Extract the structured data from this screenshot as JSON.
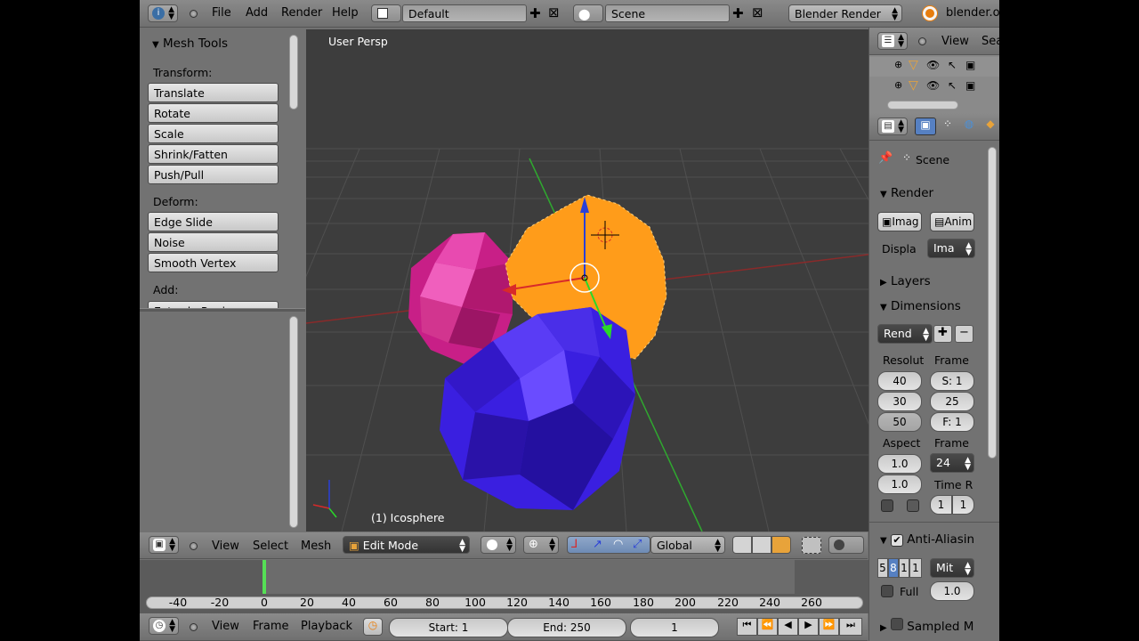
{
  "topbar": {
    "menus": [
      "File",
      "Add",
      "Render",
      "Help"
    ],
    "layout": "Default",
    "scene": "Scene",
    "engine": "Blender Render",
    "link": "blender.or"
  },
  "toolshelf": {
    "title": "Mesh Tools",
    "groups": [
      {
        "label": "Transform:",
        "items": [
          "Translate",
          "Rotate",
          "Scale",
          "Shrink/Fatten",
          "Push/Pull"
        ]
      },
      {
        "label": "Deform:",
        "items": [
          "Edge Slide",
          "Noise",
          "Smooth Vertex"
        ]
      },
      {
        "label": "Add:",
        "items": [
          "Extrude Region"
        ]
      }
    ]
  },
  "viewport": {
    "view_label": "User Persp",
    "object_label": "(1) Icosphere",
    "colors": {
      "pink": "#d0208a",
      "orange": "#f5a623",
      "blue": "#3a1fe0",
      "bg": "#3d3d3d"
    }
  },
  "view3d_header": {
    "menus": [
      "View",
      "Select",
      "Mesh"
    ],
    "mode": "Edit Mode",
    "orientation": "Global"
  },
  "outliner": {
    "view_label": "View",
    "search_label": "Sea"
  },
  "properties": {
    "context": "Scene",
    "render_section": "Render",
    "image_button": "Imag",
    "anim_button": "Anim",
    "display_label": "Displa",
    "display_value": "Ima",
    "layers_section": "Layers",
    "dimensions_section": "Dimensions",
    "preset": "Rend",
    "resolution_label": "Resolut",
    "frame_label": "Frame",
    "res_x": "40",
    "res_y": "30",
    "res_pct": "50",
    "frame_start": "S: 1",
    "frame_end": "25",
    "frame_step": "F: 1",
    "aspect_label": "Aspect",
    "frame_rate_label": "Frame",
    "aspect_x": "1.0",
    "aspect_y": "1.0",
    "fps": "24",
    "time_remap_label": "Time R",
    "time_old": "1",
    "time_new": "1",
    "aa_section": "Anti-Aliasin",
    "aa_samples": [
      "5",
      "8",
      "1",
      "1"
    ],
    "aa_filter": "Mit",
    "full_label": "Full",
    "full_value": "1.0",
    "sampled_section": "Sampled M"
  },
  "timeline": {
    "ticks": [
      "-40",
      "-20",
      "0",
      "20",
      "40",
      "60",
      "80",
      "100",
      "120",
      "140",
      "160",
      "180",
      "200",
      "220",
      "240",
      "260"
    ],
    "current_frame": "1",
    "start_label": "Start: 1",
    "end_label": "End: 250",
    "menus": [
      "View",
      "Frame",
      "Playback"
    ]
  }
}
